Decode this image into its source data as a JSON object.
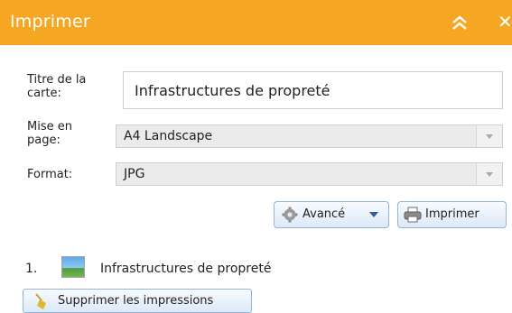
{
  "panel": {
    "title": "Imprimer",
    "collapse_icon": "double-chevron-up-icon",
    "close_label": "✕"
  },
  "form": {
    "title_label": "Titre de la carte:",
    "title_value": "Infrastructures de propreté",
    "layout_label": "Mise en page:",
    "layout_value": "A4 Landscape",
    "format_label": "Format:",
    "format_value": "JPG"
  },
  "buttons": {
    "advanced_label": "Avancé",
    "print_label": "Imprimer"
  },
  "results": {
    "items": [
      {
        "number": "1.",
        "name": "Infrastructures de propreté",
        "icon": "image-thumbnail-icon"
      }
    ],
    "clear_label": "Supprimer les impressions"
  },
  "colors": {
    "header": "#f5a623",
    "button_border": "#93b4d8"
  }
}
